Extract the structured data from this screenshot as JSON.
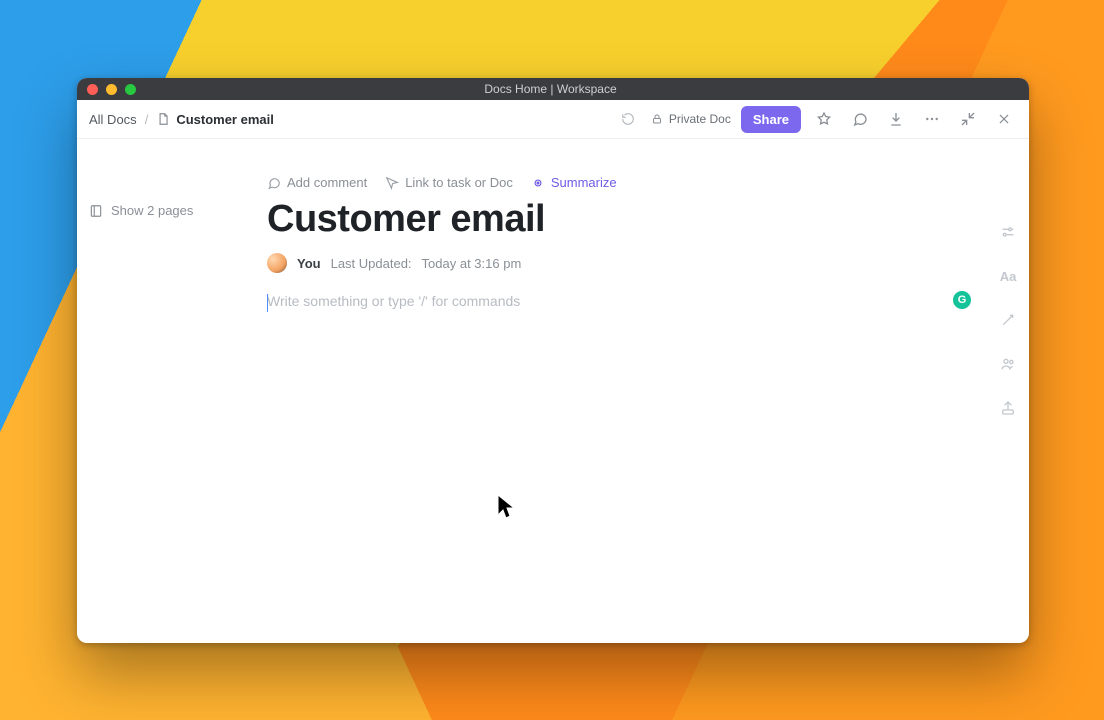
{
  "window": {
    "title": "Docs Home | Workspace"
  },
  "toolbar": {
    "breadcrumb_root": "All Docs",
    "breadcrumb_current": "Customer email",
    "privacy_label": "Private Doc",
    "share_label": "Share"
  },
  "sidebar": {
    "show_pages_label": "Show 2 pages"
  },
  "doc": {
    "actions": {
      "comment": "Add comment",
      "link": "Link to task or Doc",
      "summarize": "Summarize"
    },
    "title": "Customer email",
    "author_label": "You",
    "last_updated_label": "Last Updated:",
    "last_updated_value": "Today at 3:16 pm",
    "editor_placeholder": "Write something or type '/' for commands"
  },
  "grammarly_badge": "G",
  "icons": {
    "doc": "doc-icon",
    "lock": "lock-icon",
    "star": "star-icon",
    "chat": "chat-icon",
    "down": "download-icon",
    "more": "more-icon",
    "collapse": "collapse-icon",
    "close": "close-icon",
    "pages": "pages-icon",
    "comment": "comment-icon",
    "link": "link-icon",
    "sparkle": "sparkle-icon",
    "tune": "tune-icon",
    "aa": "text-style-icon",
    "wand": "magic-icon",
    "people": "people-icon",
    "export": "export-icon",
    "refresh": "refresh-icon"
  }
}
